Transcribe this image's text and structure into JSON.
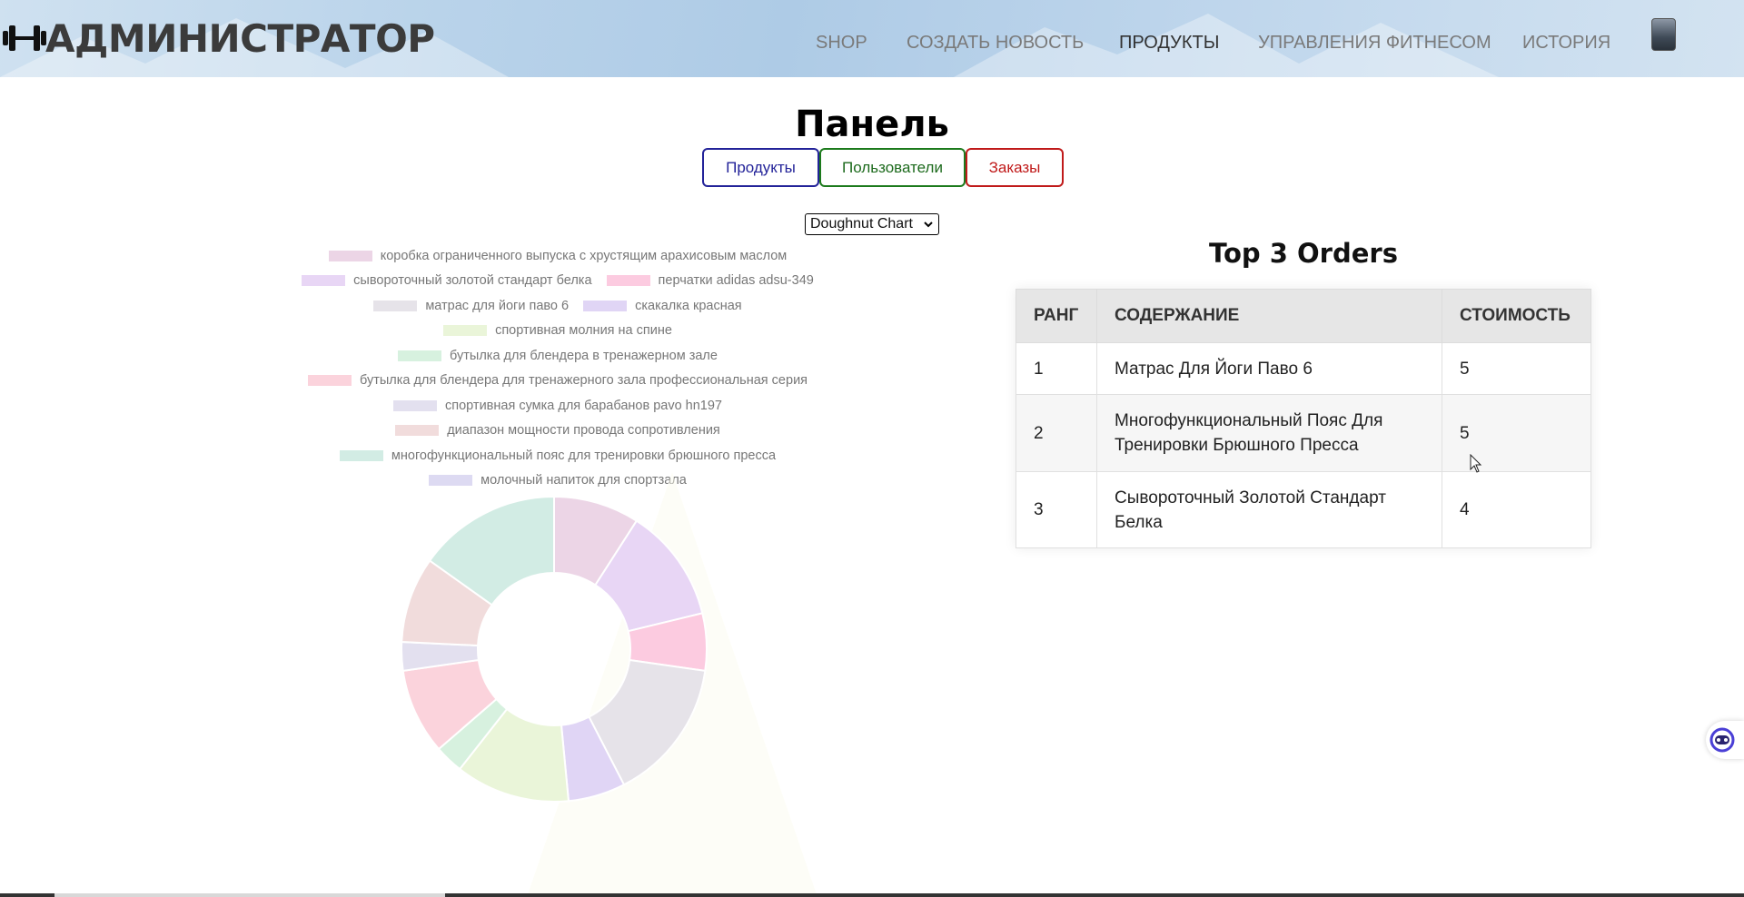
{
  "header": {
    "brand": "АДМИНИСТРАТОР",
    "brand_icon": "dumbbell-icon",
    "nav": [
      {
        "label": "SHOP",
        "active": false
      },
      {
        "label": "СОЗДАТЬ НОВОСТЬ",
        "active": false
      },
      {
        "label": "ПРОДУКТЫ",
        "active": true
      },
      {
        "label": "УПРАВЛЕНИЯ ФИТНЕСОМ",
        "active": false
      },
      {
        "label": "ИСТОРИЯ",
        "active": false
      }
    ],
    "avatar": "user-avatar"
  },
  "panel": {
    "title": "Панель",
    "tabs": {
      "products": "Продукты",
      "users": "Пользователи",
      "orders": "Заказы"
    },
    "chart_select": "Doughnut Chart"
  },
  "chart_data": {
    "type": "pie",
    "variant": "doughnut",
    "title": "",
    "legend_position": "top",
    "categories": [
      "коробка ограниченного выпуска с хрустящим арахисовым маслом",
      "сывороточный золотой стандарт белка",
      "перчатки adidas adsu-349",
      "матрас для йоги паво 6",
      "скакалка красная",
      "спортивная молния на спине",
      "бутылка для блендера в тренажерном зале",
      "бутылка для блендера для тренажерного зала профессиональная серия",
      "спортивная сумка для барабанов pavo hn197",
      "диапазон мощности провода сопротивления",
      "многофункциональный пояс для тренировки брюшного пресса",
      "молочный напиток для спортзала"
    ],
    "values": [
      3,
      4,
      2,
      5,
      2,
      4,
      1,
      3,
      1,
      3,
      5,
      0
    ],
    "colors": [
      "#ecd5e6",
      "#e8d6f5",
      "#fccbe0",
      "#e6e3e9",
      "#e0d5f5",
      "#eaf5d9",
      "#d7f1df",
      "#fbd3dc",
      "#e3e0ef",
      "#f1dcdc",
      "#d2ece4",
      "#dddaf2"
    ]
  },
  "orders": {
    "title": "Top 3 Orders",
    "headers": [
      "РАНГ",
      "СОДЕРЖАНИЕ",
      "СТОИМОСТЬ"
    ],
    "rows": [
      {
        "rank": "1",
        "content": "Матрас Для Йоги Паво 6",
        "cost": "5"
      },
      {
        "rank": "2",
        "content": "Многофункциональный Пояс Для Тренировки Брюшного Пресса",
        "cost": "5"
      },
      {
        "rank": "3",
        "content": "Сывороточный Золотой Стандарт Белка",
        "cost": "4"
      }
    ]
  },
  "assistant": {
    "icon": "robot-icon"
  }
}
